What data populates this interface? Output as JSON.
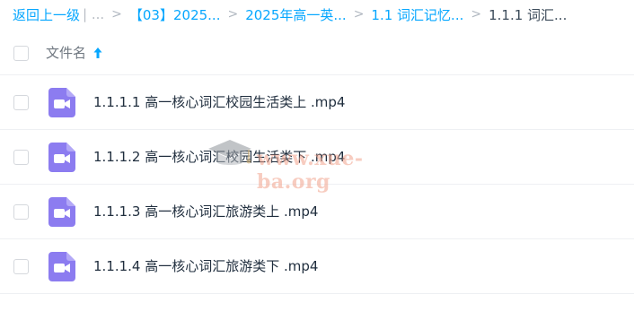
{
  "breadcrumb": {
    "back_label": "返回上一级",
    "divider_text": "| ...",
    "items": [
      {
        "label": "【03】2025..."
      },
      {
        "label": "2025年高一英..."
      },
      {
        "label": "1.1 词汇记忆..."
      },
      {
        "label": "1.1.1 词汇..."
      }
    ]
  },
  "list_header": {
    "name_column": "文件名",
    "sort_direction": "ascending"
  },
  "files": [
    {
      "name": "1.1.1.1 高一核心词汇校园生活类上 .mp4",
      "type": "video"
    },
    {
      "name": "1.1.1.2 高一核心词汇校园生活类下 .mp4",
      "type": "video"
    },
    {
      "name": "1.1.1.3 高一核心词汇旅游类上 .mp4",
      "type": "video"
    },
    {
      "name": "1.1.1.4 高一核心词汇旅游类下 .mp4",
      "type": "video"
    }
  ],
  "watermark": {
    "text": "www.xue-ba.org"
  },
  "colors": {
    "link": "#06a7ff",
    "video_icon": "#8c7cf0",
    "watermark": "#f2a48d"
  }
}
